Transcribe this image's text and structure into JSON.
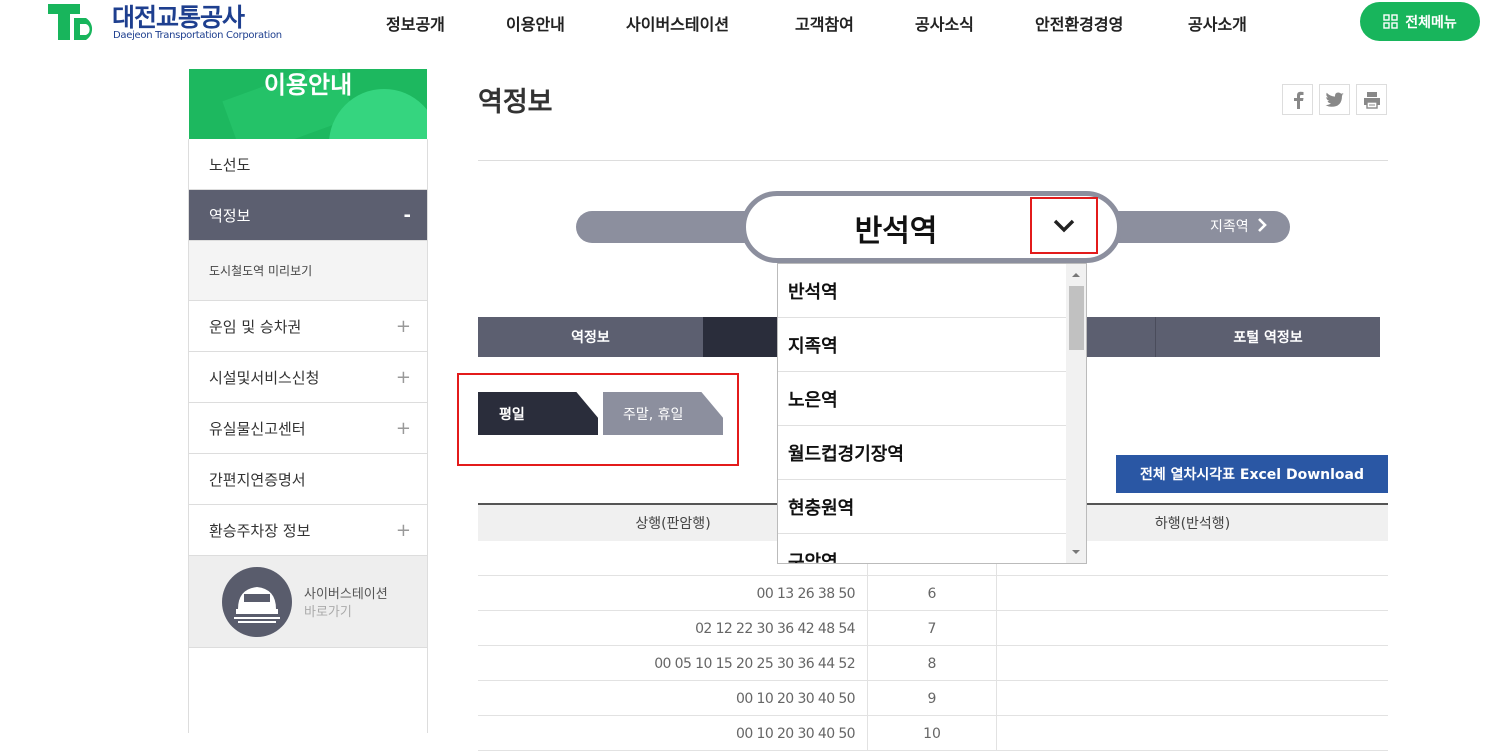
{
  "header": {
    "logo_title": "대전교통공사",
    "logo_sub": "Daejeon Transportation Corporation",
    "nav": [
      "정보공개",
      "이용안내",
      "사이버스테이션",
      "고객참여",
      "공사소식",
      "안전환경경영",
      "공사소개"
    ],
    "all_menu_label": "전체메뉴",
    "brand_color": "#18b55c"
  },
  "sidebar": {
    "hero_title": "이용안내",
    "items": [
      {
        "label": "노선도"
      },
      {
        "label": "역정보",
        "toggle": "-"
      },
      {
        "label": "도시철도역 미리보기"
      },
      {
        "label": "운임 및 승차권",
        "toggle": "+"
      },
      {
        "label": "시설및서비스신청",
        "toggle": "+"
      },
      {
        "label": "유실물신고센터",
        "toggle": "+"
      },
      {
        "label": "간편지연증명서"
      },
      {
        "label": "환승주차장 정보",
        "toggle": "+"
      }
    ],
    "cyber_station": {
      "line1": "사이버스테이션",
      "line2": "바로가기"
    }
  },
  "main": {
    "page_title": "역정보",
    "share_icons": [
      "facebook-icon",
      "twitter-icon",
      "print-icon"
    ],
    "station": {
      "current": "반석역",
      "next": "지족역"
    },
    "tabs": [
      "역정보",
      "",
      "",
      "포털 역정보"
    ],
    "day_buttons": {
      "weekday": "평일",
      "weekend": "주말, 휴일"
    },
    "excel_button": "전체 열차시각표 Excel Download",
    "table": {
      "headers": {
        "up": "상행(판암행)",
        "down": "하행(반석행)"
      },
      "rows": [
        {
          "up": "",
          "hour": ""
        },
        {
          "up": "00 13 26 38 50",
          "hour": "6"
        },
        {
          "up": "02 12 22 30 36 42 48 54",
          "hour": "7"
        },
        {
          "up": "00 05 10 15 20 25 30 36 44 52",
          "hour": "8"
        },
        {
          "up": "00 10 20 30 40 50",
          "hour": "9"
        },
        {
          "up": "00 10 20 30 40 50",
          "hour": "10"
        }
      ]
    },
    "dropdown_options": [
      "반석역",
      "지족역",
      "노은역",
      "월드컵경기장역",
      "현충원역",
      "구암역"
    ]
  }
}
